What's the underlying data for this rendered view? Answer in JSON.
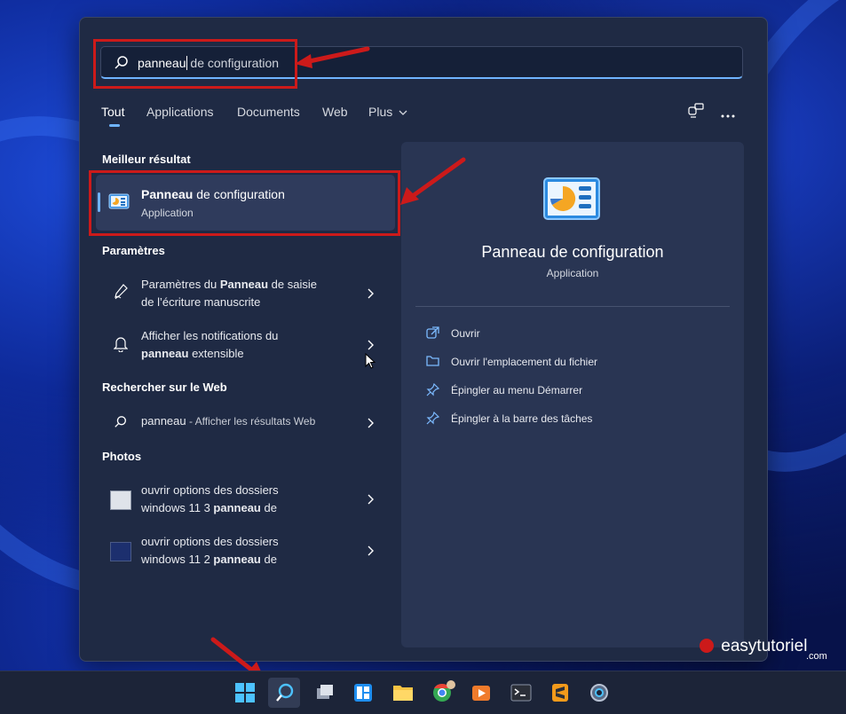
{
  "search": {
    "typed": "panneau",
    "suggestion": " de configuration"
  },
  "tabs": [
    {
      "label": "Tout"
    },
    {
      "label": "Applications"
    },
    {
      "label": "Documents"
    },
    {
      "label": "Web"
    },
    {
      "label": "Plus"
    }
  ],
  "sections": {
    "best": "Meilleur résultat",
    "settings": "Paramètres",
    "web": "Rechercher sur le Web",
    "photos": "Photos"
  },
  "best_match": {
    "name_bold": "Panneau",
    "name_rest": " de configuration",
    "type": "Application"
  },
  "settings_items": [
    {
      "l1_pre": "Paramètres du ",
      "l1_bold": "Panneau",
      "l1_post": " de saisie",
      "l2": "de l’écriture manuscrite"
    },
    {
      "l1": "Afficher les notifications du",
      "l2_bold": "panneau",
      "l2_post": " extensible"
    }
  ],
  "web_item": {
    "query": "panneau",
    "suffix": " - Afficher les résultats Web"
  },
  "photo_items": [
    {
      "l1": "ouvrir options des dossiers",
      "l2_pre": "windows 11 3 ",
      "l2_bold": "panneau",
      "l2_post": " de"
    },
    {
      "l1": "ouvrir options des dossiers",
      "l2_pre": "windows 11 2 ",
      "l2_bold": "panneau",
      "l2_post": " de"
    }
  ],
  "detail": {
    "title": "Panneau de configuration",
    "subtitle": "Application",
    "actions": [
      {
        "label": "Ouvrir",
        "icon": "open-icon"
      },
      {
        "label": "Ouvrir l'emplacement du fichier",
        "icon": "folder-icon"
      },
      {
        "label": "Épingler au menu Démarrer",
        "icon": "pin-icon"
      },
      {
        "label": "Épingler à la barre des tâches",
        "icon": "pin-icon"
      }
    ]
  },
  "watermark": {
    "brand": "easytutoriel",
    "tld": ".com"
  },
  "colors": {
    "accent": "#6fb4ff",
    "highlight": "#cc1a1a"
  }
}
